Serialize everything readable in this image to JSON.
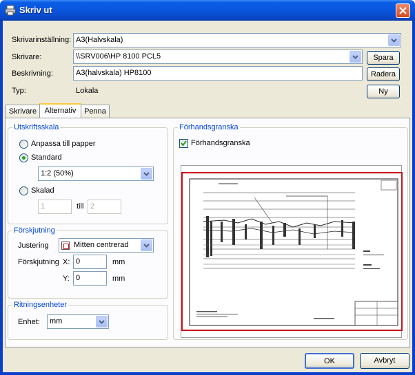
{
  "window": {
    "title": "Skriv ut"
  },
  "header": {
    "printer_setting_label": "Skrivarinställning:",
    "printer_setting_value": "A3(Halvskala)",
    "printer_label": "Skrivare:",
    "printer_value": "\\\\SRV006\\HP 8100 PCL5",
    "description_label": "Beskrivning:",
    "description_value": "A3(halvskala) HP8100",
    "type_label": "Typ:",
    "type_value": "Lokala",
    "save_label": "Spara",
    "delete_label": "Radera",
    "new_label": "Ny"
  },
  "tabs": [
    {
      "label": "Skrivare"
    },
    {
      "label": "Alternativ"
    },
    {
      "label": "Penna"
    }
  ],
  "scale": {
    "title": "Utskriftsskala",
    "fit_label": "Anpassa till papper",
    "standard_label": "Standard",
    "standard_value": "1:2   (50%)",
    "scaled_label": "Skalad",
    "from_value": "1",
    "to_label": "till",
    "to_value": "2"
  },
  "offset": {
    "title": "Förskjutning",
    "justify_label": "Justering",
    "justify_value": "Mitten centrerad",
    "offset_label": "Förskjutning",
    "x_label": "X:",
    "x_value": "0",
    "x_unit": "mm",
    "y_label": "Y:",
    "y_value": "0",
    "y_unit": "mm"
  },
  "units": {
    "title": "Ritningsenheter",
    "unit_label": "Enhet:",
    "unit_value": "mm"
  },
  "preview": {
    "title": "Förhandsgranska",
    "checkbox_label": "Förhandsgranska",
    "checked": true
  },
  "footer": {
    "ok_label": "OK",
    "cancel_label": "Avbryt"
  }
}
